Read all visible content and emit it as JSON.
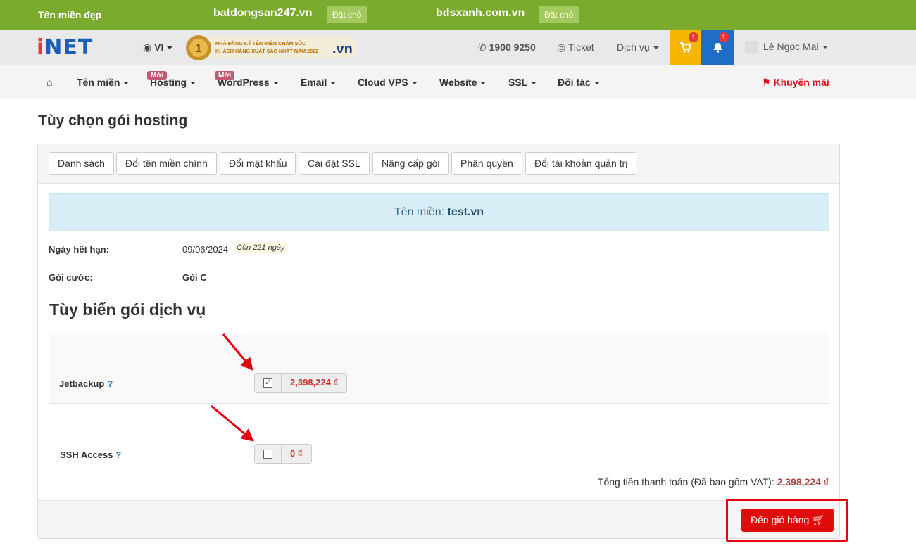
{
  "promo": {
    "label": "Tên miền đẹp",
    "domain1": "batdongsan247.vn",
    "badge1": "Đặt chỗ",
    "domain2": "bdsxanh.com.vn",
    "badge2": "Đặt chỗ"
  },
  "header": {
    "logo": "iNET",
    "lang": "VI",
    "award_line1": "NHÀ ĐĂNG KÝ TÊN MIỀN CHĂM SÓC",
    "award_line2": "KHÁCH HÀNG XUẤT SẮC NHẤT NĂM 2022",
    "award_badge": ".vn",
    "phone": "1900 9250",
    "ticket": "Ticket",
    "services": "Dịch vụ",
    "cart_count": "1",
    "notif_count": "1",
    "user": "Lê Ngọc Mai"
  },
  "nav": {
    "items": [
      "Tên miền",
      "Hosting",
      "WordPress",
      "Email",
      "Cloud VPS",
      "Website",
      "SSL",
      "Đối tác"
    ],
    "new_badge": "Mới",
    "promo": "Khuyến mãi"
  },
  "page": {
    "title": "Tùy chọn gói hosting",
    "tabs": [
      "Danh sách",
      "Đổi tên miền chính",
      "Đổi mật khẩu",
      "Cài đặt SSL",
      "Nâng cấp gói",
      "Phân quyền",
      "Đổi tài khoản quản trị"
    ],
    "domain_label": "Tên miền:",
    "domain": "test.vn",
    "expiry_label": "Ngày hết hạn:",
    "expiry": "09/06/2024",
    "remaining": "Còn 221 ngày",
    "plan_label": "Gói cước:",
    "plan": "Gói C",
    "customize_title": "Tùy biến gói dịch vụ",
    "addons": [
      {
        "name": "Jetbackup",
        "help": "?",
        "checked": true,
        "price": "2,398,224 ₫"
      },
      {
        "name": "SSH Access",
        "help": "?",
        "checked": false,
        "price": "0 ₫"
      }
    ],
    "total_label": "Tổng tiền thanh toán (Đã bao gồm VAT):",
    "total": "2,398,224 ₫",
    "cart_button": "Đến giỏ hàng"
  },
  "colors": {
    "promo_bar": "#7aab2e",
    "cart": "#f7b500",
    "bell": "#1e6ec8",
    "accent_red": "#e00b0b",
    "annotation": "#e3000f"
  }
}
